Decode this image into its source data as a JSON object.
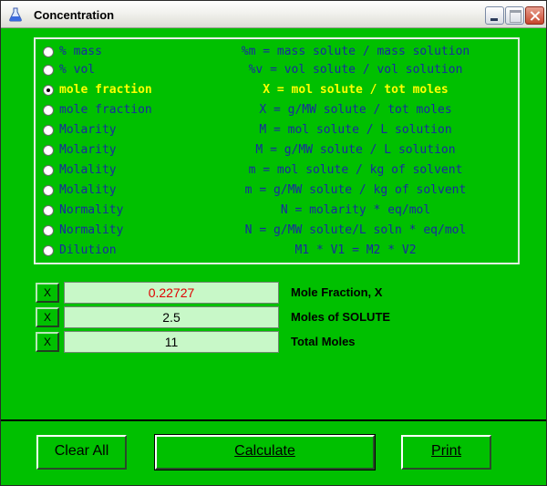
{
  "window": {
    "title": "Concentration"
  },
  "options": [
    {
      "label": "% mass",
      "formula": "%m = mass solute / mass solution",
      "selected": false
    },
    {
      "label": "% vol",
      "formula": "%v = vol solute / vol solution",
      "selected": false
    },
    {
      "label": "mole fraction",
      "formula": "X = mol solute / tot moles",
      "selected": true
    },
    {
      "label": "mole fraction",
      "formula": "X = g/MW solute / tot moles",
      "selected": false
    },
    {
      "label": "Molarity",
      "formula": "M = mol solute / L solution",
      "selected": false
    },
    {
      "label": "Molarity",
      "formula": "M = g/MW solute / L solution",
      "selected": false
    },
    {
      "label": "Molality",
      "formula": "m = mol solute / kg of solvent",
      "selected": false
    },
    {
      "label": "Molality",
      "formula": "m = g/MW solute / kg of solvent",
      "selected": false
    },
    {
      "label": "Normality",
      "formula": "N = molarity * eq/mol",
      "selected": false
    },
    {
      "label": "Normality",
      "formula": "N = g/MW solute/L soln * eq/mol",
      "selected": false
    },
    {
      "label": "Dilution",
      "formula": "M1 * V1 = M2 * V2",
      "selected": false
    }
  ],
  "values": [
    {
      "clear": "X",
      "value": "0.22727",
      "label": "Mole Fraction, X"
    },
    {
      "clear": "X",
      "value": "2.5",
      "label": "Moles of SOLUTE"
    },
    {
      "clear": "X",
      "value": "11",
      "label": "Total Moles"
    }
  ],
  "buttons": {
    "clear_all": "Clear All",
    "calculate": "Calculate",
    "print": "Print"
  },
  "colors": {
    "background": "#00c000",
    "option_text": "#1a2aa0",
    "selected_text": "#ffff00",
    "result_text": "#e00000",
    "field_bg": "#c8f8c8"
  }
}
